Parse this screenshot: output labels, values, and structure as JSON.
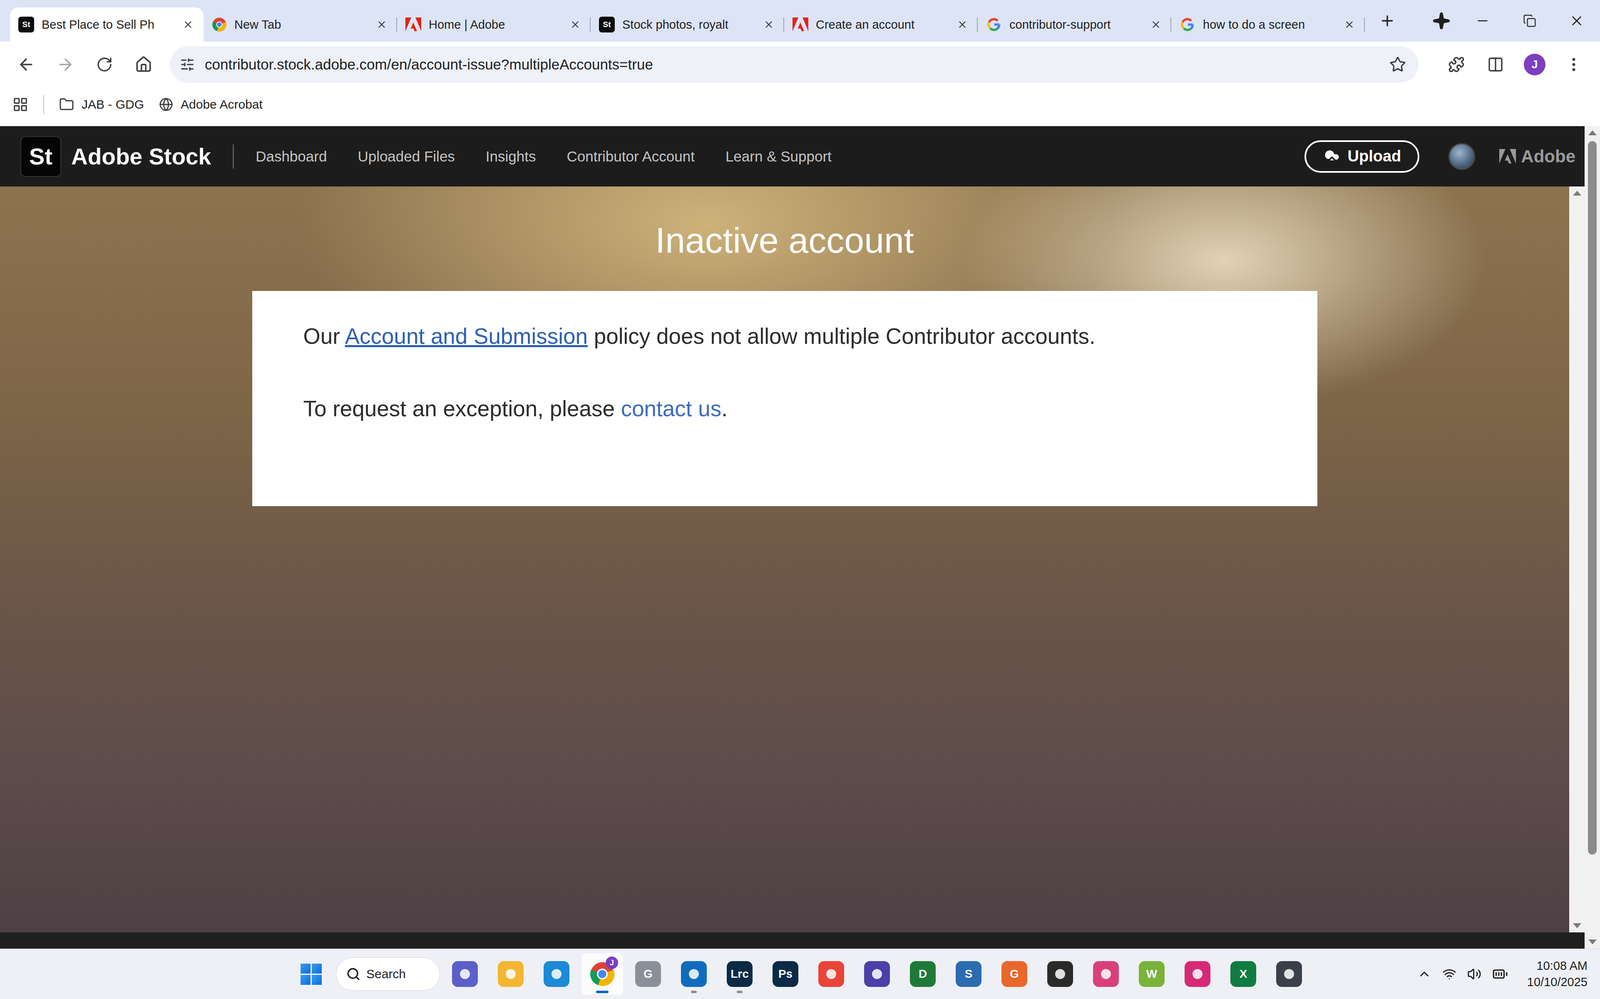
{
  "browser": {
    "tabs": [
      {
        "label": "Best Place to Sell Ph",
        "kind": "stock",
        "selected": true
      },
      {
        "label": "New Tab",
        "kind": "chrome",
        "selected": false
      },
      {
        "label": "Home | Adobe",
        "kind": "adobe",
        "selected": false
      },
      {
        "label": "Stock photos, royalt",
        "kind": "stock",
        "selected": false
      },
      {
        "label": "Create an account",
        "kind": "adobe",
        "selected": false
      },
      {
        "label": "contributor-support",
        "kind": "google",
        "selected": false
      },
      {
        "label": "how to do a screen",
        "kind": "google",
        "selected": false
      }
    ],
    "url": "contributor.stock.adobe.com/en/account-issue?multipleAccounts=true",
    "profile_initial": "J",
    "bookmarks": [
      {
        "label": "JAB - GDG",
        "kind": "folder"
      },
      {
        "label": "Adobe Acrobat",
        "kind": "globe"
      }
    ],
    "scrollbar": {
      "level": 0.9
    }
  },
  "header": {
    "logo_mark": "St",
    "brand": "Adobe Stock",
    "nav": [
      {
        "label": "Dashboard",
        "selected": false
      },
      {
        "label": "Uploaded Files",
        "selected": false
      },
      {
        "label": "Insights",
        "selected": false
      },
      {
        "label": "Contributor Account",
        "selected": false
      },
      {
        "label": "Learn & Support",
        "selected": false
      }
    ],
    "upload": "Upload",
    "adobe": "Adobe"
  },
  "page": {
    "title": "Inactive account",
    "message": {
      "before": "Our ",
      "link": "Account and Submission",
      "after": " policy does not allow multiple Contributor accounts."
    },
    "exception": {
      "before": "To request an exception, please ",
      "link": "contact us",
      "after": "."
    }
  },
  "taskbar": {
    "search": "Search",
    "apps": [
      {
        "kind": "teams",
        "glyph": "",
        "color": "#5b5fc7",
        "running": false,
        "selected": false
      },
      {
        "kind": "explorer",
        "glyph": "",
        "color": "#f2b632",
        "running": false,
        "selected": false
      },
      {
        "kind": "edge",
        "glyph": "",
        "color": "#1c8ad6",
        "running": false,
        "selected": false
      },
      {
        "kind": "chrome",
        "glyph": "",
        "color": "#4285f4",
        "running": true,
        "selected": true,
        "badge": "J"
      },
      {
        "kind": "google",
        "glyph": "G",
        "color": "#8a8f98",
        "running": false,
        "selected": false
      },
      {
        "kind": "outlook",
        "glyph": "",
        "color": "#0f6cbd",
        "running": true,
        "selected": false
      },
      {
        "kind": "lightroom",
        "glyph": "Lrc",
        "color": "#0a2a45",
        "running": true,
        "selected": false
      },
      {
        "kind": "photoshop",
        "glyph": "Ps",
        "color": "#0a2a45",
        "running": false,
        "selected": false
      },
      {
        "kind": "creative-cloud",
        "glyph": "",
        "color": "#e8443a",
        "running": false,
        "selected": false
      },
      {
        "kind": "gem",
        "glyph": "",
        "color": "#4b3fa8",
        "running": false,
        "selected": false
      },
      {
        "kind": "d-app",
        "glyph": "D",
        "color": "#1f7a3a",
        "running": false,
        "selected": false
      },
      {
        "kind": "s-app",
        "glyph": "S",
        "color": "#2b6cb0",
        "running": false,
        "selected": false
      },
      {
        "kind": "g-app",
        "glyph": "G",
        "color": "#e8672a",
        "running": false,
        "selected": false
      },
      {
        "kind": "dark-app",
        "glyph": "",
        "color": "#2a2a2a",
        "running": false,
        "selected": false
      },
      {
        "kind": "prism",
        "glyph": "",
        "color": "#d9407a",
        "running": false,
        "selected": false
      },
      {
        "kind": "w-app",
        "glyph": "W",
        "color": "#7ab23a",
        "running": false,
        "selected": false
      },
      {
        "kind": "instagram",
        "glyph": "",
        "color": "#d62976",
        "running": false,
        "selected": false
      },
      {
        "kind": "excel",
        "glyph": "X",
        "color": "#107c41",
        "running": false,
        "selected": false
      },
      {
        "kind": "davinci",
        "glyph": "",
        "color": "#3a3f4a",
        "running": false,
        "selected": false
      }
    ],
    "time": "10:08 AM",
    "date": "10/10/2025"
  }
}
